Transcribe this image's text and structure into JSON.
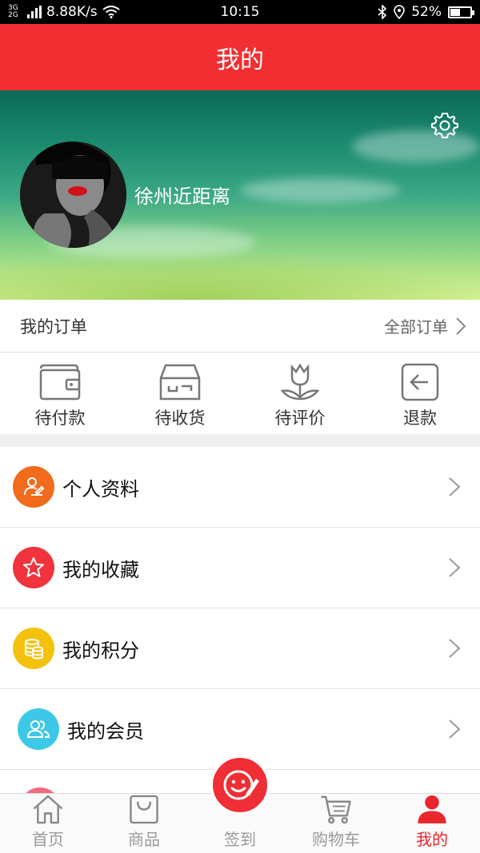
{
  "status_bar": {
    "network": "3G 2G",
    "speed": "8.88K/s",
    "time": "10:15",
    "battery_text": "52%",
    "battery_level": 0.52
  },
  "header": {
    "title": "我的"
  },
  "profile": {
    "username": "徐州近距离"
  },
  "orders": {
    "title": "我的订单",
    "all_label": "全部订单",
    "statuses": [
      {
        "label": "待付款",
        "icon": "wallet-icon"
      },
      {
        "label": "待收货",
        "icon": "box-icon"
      },
      {
        "label": "待评价",
        "icon": "tulip-icon"
      },
      {
        "label": "退款",
        "icon": "return-icon"
      }
    ]
  },
  "menu": [
    {
      "label": "个人资料",
      "icon": "profile-edit-icon",
      "color": "#f26a1b"
    },
    {
      "label": "我的收藏",
      "icon": "star-icon",
      "color": "#f0333d"
    },
    {
      "label": "我的积分",
      "icon": "coins-icon",
      "color": "#f4c20d"
    },
    {
      "label": "我的会员",
      "icon": "members-icon",
      "color": "#3ec8e8"
    }
  ],
  "tabbar": {
    "tabs": [
      {
        "label": "首页",
        "icon": "home-icon"
      },
      {
        "label": "商品",
        "icon": "bag-icon"
      },
      {
        "label": "签到",
        "icon": "smile-pen-icon"
      },
      {
        "label": "购物车",
        "icon": "cart-icon"
      },
      {
        "label": "我的",
        "icon": "user-icon"
      }
    ],
    "active_color": "#e8262c",
    "inactive_color": "#999999"
  },
  "colors": {
    "brand_red": "#f22f33"
  }
}
